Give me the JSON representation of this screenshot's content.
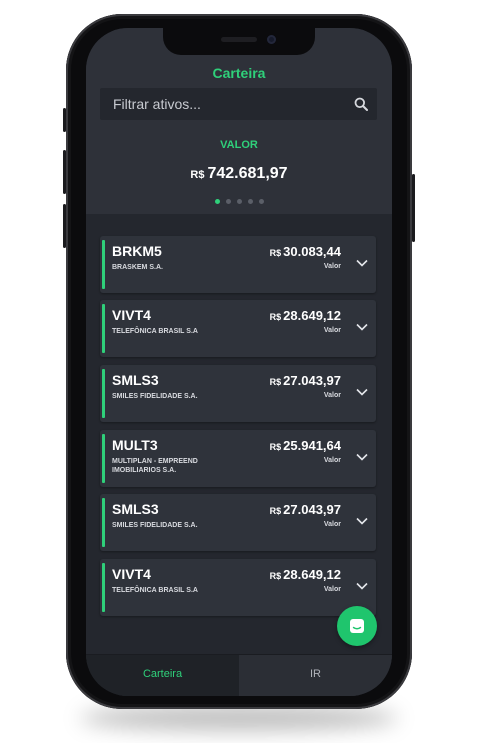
{
  "app": {
    "title": "Carteira"
  },
  "search": {
    "placeholder": "Filtrar ativos..."
  },
  "summary": {
    "label": "VALOR",
    "currency": "R$",
    "amount": "742.681,97",
    "page_count": 5,
    "active_page": 1
  },
  "positions": [
    {
      "ticker": "BRKM5",
      "company": "BRASKEM S.A.",
      "currency": "R$",
      "amount": "30.083,44",
      "amount_label": "Valor"
    },
    {
      "ticker": "VIVT4",
      "company": "TELEFÔNICA BRASIL S.A",
      "currency": "R$",
      "amount": "28.649,12",
      "amount_label": "Valor"
    },
    {
      "ticker": "SMLS3",
      "company": "SMILES FIDELIDADE S.A.",
      "currency": "R$",
      "amount": "27.043,97",
      "amount_label": "Valor"
    },
    {
      "ticker": "MULT3",
      "company": "MULTIPLAN - EMPREEND IMOBILIARIOS S.A.",
      "currency": "R$",
      "amount": "25.941,64",
      "amount_label": "Valor"
    },
    {
      "ticker": "SMLS3",
      "company": "SMILES FIDELIDADE S.A.",
      "currency": "R$",
      "amount": "27.043,97",
      "amount_label": "Valor"
    },
    {
      "ticker": "VIVT4",
      "company": "TELEFÔNICA BRASIL S.A",
      "currency": "R$",
      "amount": "28.649,12",
      "amount_label": "Valor"
    }
  ],
  "tabs": [
    {
      "label": "Carteira",
      "active": true
    },
    {
      "label": "IR",
      "active": false
    }
  ],
  "icons": {
    "search": "search-icon",
    "expand": "chevron-down-icon",
    "chat": "chat-icon"
  },
  "colors": {
    "accent": "#2fd07a",
    "background": "#24272e",
    "card": "#2f333b"
  }
}
